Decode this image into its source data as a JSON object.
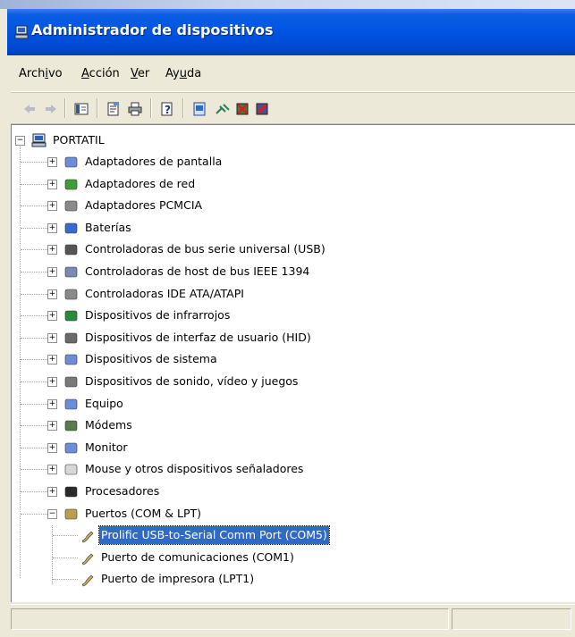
{
  "window": {
    "title": "Administrador de dispositivos"
  },
  "menu": [
    {
      "before": "Arch",
      "key": "i",
      "after": "vo"
    },
    {
      "before": "",
      "key": "A",
      "after": "cción"
    },
    {
      "before": "",
      "key": "V",
      "after": "er"
    },
    {
      "before": "Ay",
      "key": "u",
      "after": "da"
    }
  ],
  "toolbar": {
    "buttons": [
      "back-arrow-icon",
      "forward-arrow-icon",
      "console-tree-icon",
      "properties-icon",
      "print-icon",
      "help-icon",
      "update-driver-icon",
      "scan-hardware-icon",
      "uninstall-icon",
      "disable-icon"
    ]
  },
  "tree": {
    "root": "PORTATIL",
    "categories": [
      "Adaptadores de pantalla",
      "Adaptadores de red",
      "Adaptadores PCMCIA",
      "Baterías",
      "Controladoras de bus serie universal (USB)",
      "Controladoras de host de bus IEEE 1394",
      "Controladoras IDE ATA/ATAPI",
      "Dispositivos de infrarrojos",
      "Dispositivos de interfaz de usuario (HID)",
      "Dispositivos de sistema",
      "Dispositivos de sonido, vídeo y juegos",
      "Equipo",
      "Módems",
      "Monitor",
      "Mouse y otros dispositivos señaladores",
      "Procesadores",
      "Puertos (COM & LPT)"
    ],
    "ports": [
      "Prolific USB-to-Serial Comm Port (COM5)",
      "Puerto de comunicaciones (COM1)",
      "Puerto de impresora (LPT1)"
    ],
    "selected": "Prolific USB-to-Serial Comm Port (COM5)"
  }
}
